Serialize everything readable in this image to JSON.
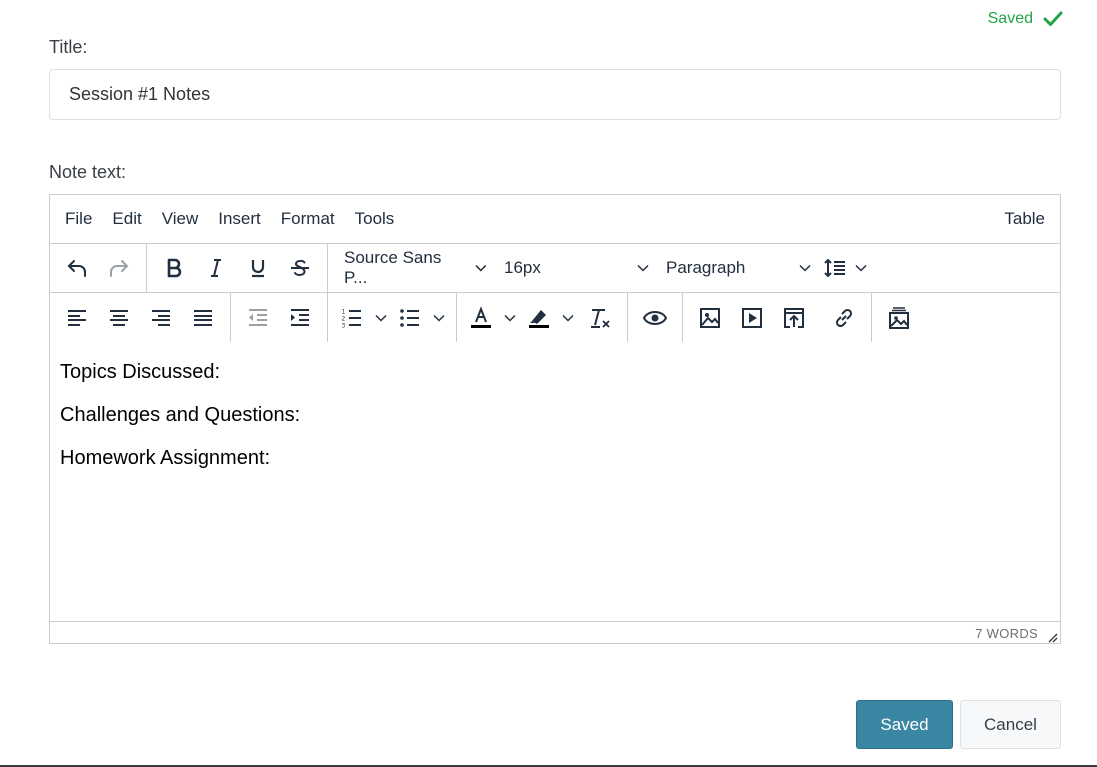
{
  "status": {
    "saved_text": "Saved",
    "color": "#22a447"
  },
  "form": {
    "title_label": "Title:",
    "title_value": "Session #1 Notes",
    "note_label": "Note text:"
  },
  "editor": {
    "menu": [
      "File",
      "Edit",
      "View",
      "Insert",
      "Format",
      "Tools"
    ],
    "menu_right": "Table",
    "font_family": "Source Sans P...",
    "font_size": "16px",
    "block_format": "Paragraph",
    "content": [
      "Topics Discussed:",
      "Challenges and Questions:",
      "Homework Assignment:"
    ],
    "word_count": "7 WORDS"
  },
  "actions": {
    "save_label": "Saved",
    "cancel_label": "Cancel",
    "save_color": "#3a87a3"
  },
  "icons": {
    "toolbar1": [
      "undo-icon",
      "redo-icon",
      "bold-icon",
      "italic-icon",
      "underline-icon",
      "strikethrough-icon",
      "line-height-icon"
    ],
    "toolbar2": [
      "align-left-icon",
      "align-center-icon",
      "align-right-icon",
      "align-justify-icon",
      "outdent-icon",
      "indent-icon",
      "numbered-list-icon",
      "bullet-list-icon",
      "text-color-icon",
      "highlight-icon",
      "clear-format-icon",
      "preview-icon",
      "image-icon",
      "media-icon",
      "upload-icon",
      "link-icon",
      "gallery-icon"
    ]
  }
}
